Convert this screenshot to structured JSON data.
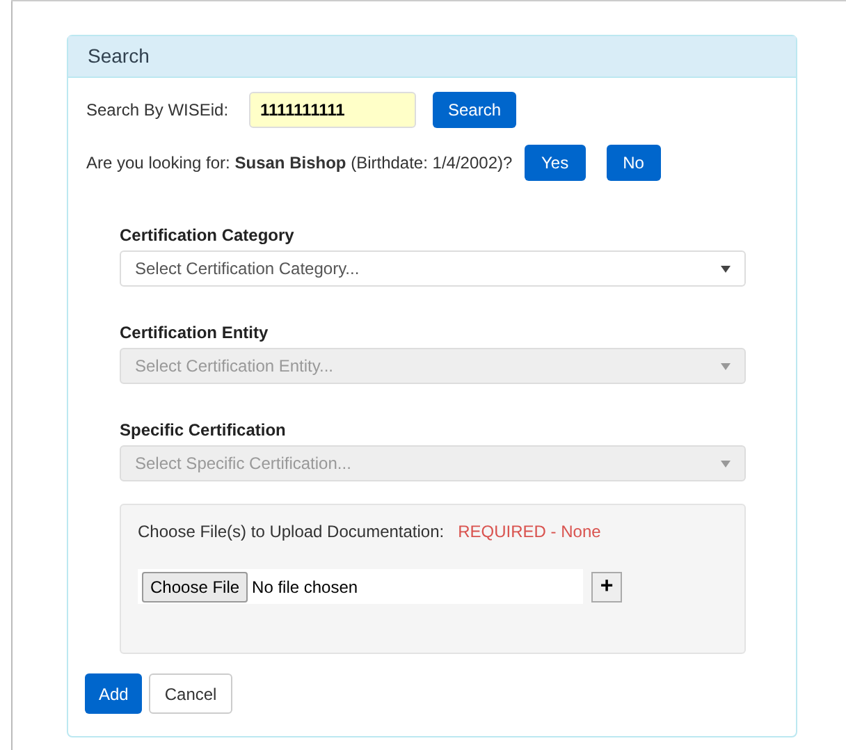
{
  "panel": {
    "title": "Search"
  },
  "search": {
    "label": "Search By WISEid:",
    "value": "1111111111",
    "button": "Search"
  },
  "confirm": {
    "text": "Are you looking for: **Susan Bishop** (Birthdate: 1/4/2002)?",
    "buttons": [
      "Yes",
      "No"
    ]
  },
  "selects": [
    {
      "label": "Certification Category",
      "placeholder": "Select Certification Category...",
      "disabled": false
    },
    {
      "label": "Certification Entity",
      "placeholder": "Select Certification Entity...",
      "disabled": true
    },
    {
      "label": "Specific Certification",
      "placeholder": "Select Specific Certification...",
      "disabled": true
    }
  ],
  "upload": {
    "label": "Choose File(s) to Upload Documentation:",
    "status": "REQUIRED - None",
    "choose_button": "Choose File",
    "file_text": "No file chosen",
    "add_symbol": "+"
  },
  "actions": [
    {
      "label": "Add",
      "kind": "primary"
    },
    {
      "label": "Cancel",
      "kind": "default"
    }
  ]
}
